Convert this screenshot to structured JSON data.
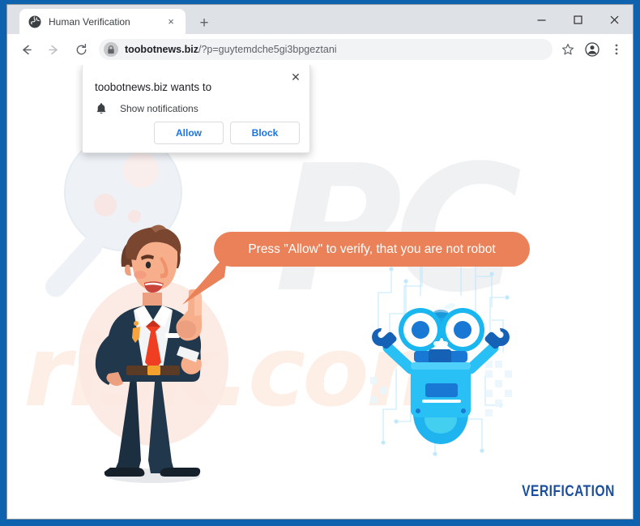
{
  "browser": {
    "tab": {
      "title": "Human Verification",
      "favicon": "globe-icon",
      "close_label": "×"
    },
    "new_tab_label": "+",
    "window_controls": {
      "minimize": "–",
      "maximize": "□",
      "close": "×"
    },
    "toolbar": {
      "back": "back-arrow-icon",
      "forward": "forward-arrow-icon",
      "reload": "reload-icon",
      "lock": "lock-icon",
      "url_host": "toobotnews.biz",
      "url_path": "/?p=guytemdche5gi3bpgeztani",
      "bookmark": "star-icon",
      "profile": "profile-avatar-icon",
      "menu": "three-dot-menu-icon"
    }
  },
  "permission_dialog": {
    "title": "toobotnews.biz wants to",
    "permission_icon": "bell-icon",
    "permission_label": "Show notifications",
    "allow_label": "Allow",
    "block_label": "Block",
    "close_label": "✕"
  },
  "page": {
    "bubble_text": "Press \"Allow\" to verify, that you are not robot",
    "verification_label": "VERIFICATION",
    "watermark_primary": "PC",
    "watermark_secondary": "risk.com",
    "colors": {
      "bubble": "#ea8158",
      "verification": "#1b4f9c",
      "robot": "#29c0f5",
      "suit": "#21374b",
      "tie": "#ef3e22",
      "frame": "#0f62ad",
      "link": "#1a73e8"
    }
  }
}
